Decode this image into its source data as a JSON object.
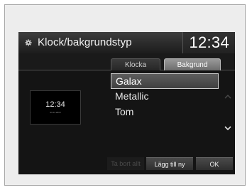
{
  "header": {
    "title": "Klock/bakgrundstyp",
    "clock": "12:34",
    "icon": "gear-icon"
  },
  "tabs": [
    {
      "label": "Klocka",
      "active": false
    },
    {
      "label": "Bakgrund",
      "active": true
    }
  ],
  "preview": {
    "time": "12:34",
    "date": "01.01.2015"
  },
  "list": {
    "items": [
      {
        "label": "Galax",
        "selected": true
      },
      {
        "label": "Metallic",
        "selected": false
      },
      {
        "label": "Tom",
        "selected": false
      }
    ]
  },
  "buttons": {
    "delete_label": "Ta bort allt",
    "add_label": "Lägg till ny",
    "ok_label": "OK"
  },
  "colors": {
    "screen_bg": "#141414",
    "frame_bg": "#ededed",
    "active_tab": "#8a8a8a"
  }
}
